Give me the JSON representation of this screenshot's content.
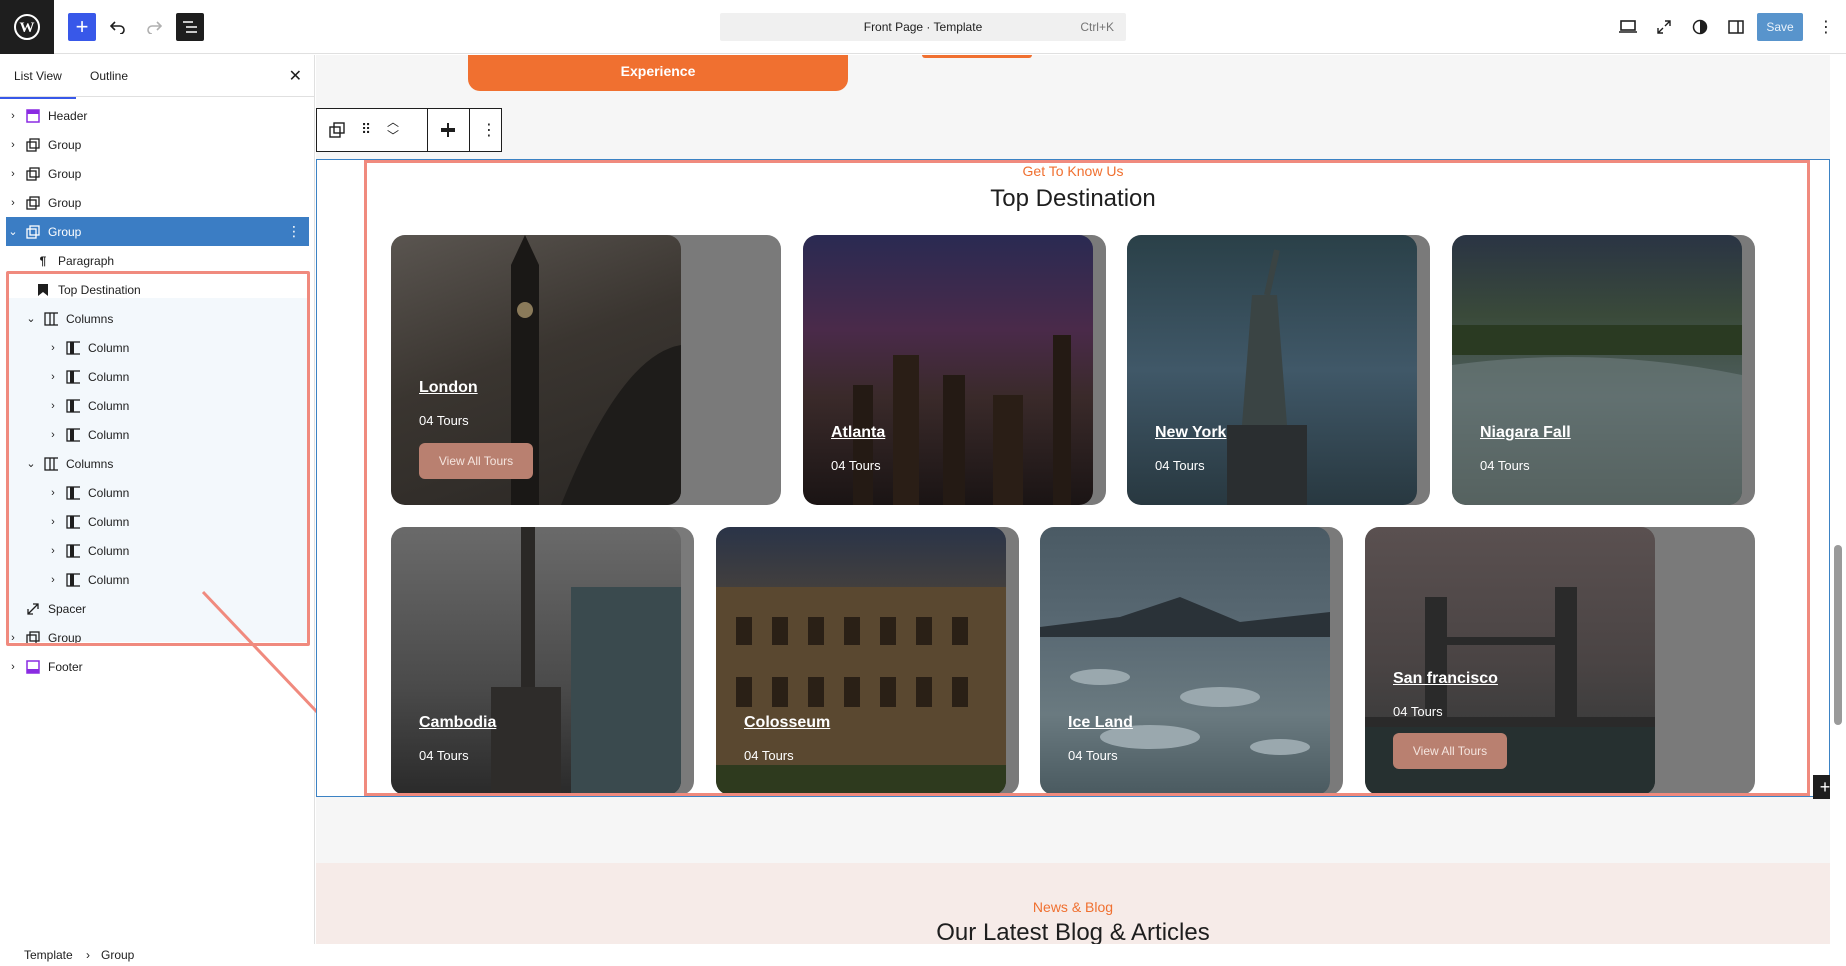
{
  "topbar": {
    "doc_title": "Front Page · Template",
    "shortcut": "Ctrl+K",
    "save_label": "Save",
    "icons": [
      "wordpress-logo",
      "plus-icon",
      "undo-icon",
      "redo-icon",
      "list-view-icon",
      "desktop-icon",
      "fullscreen-icon",
      "contrast-icon",
      "sidebar-icon",
      "more-icon"
    ]
  },
  "sidebar": {
    "tabs": [
      "List View",
      "Outline"
    ],
    "items": [
      {
        "label": "Header",
        "icon": "template-part-icon"
      },
      {
        "label": "Group",
        "icon": "group-icon"
      },
      {
        "label": "Group",
        "icon": "group-icon"
      },
      {
        "label": "Group",
        "icon": "group-icon"
      },
      {
        "label": "Group",
        "icon": "group-icon"
      },
      {
        "label": "Paragraph",
        "icon": "paragraph-icon"
      },
      {
        "label": "Top Destination",
        "icon": "heading-icon"
      },
      {
        "label": "Columns",
        "icon": "columns-icon"
      },
      {
        "label": "Column",
        "icon": "column-icon"
      },
      {
        "label": "Column",
        "icon": "column-icon"
      },
      {
        "label": "Column",
        "icon": "column-icon"
      },
      {
        "label": "Column",
        "icon": "column-icon"
      },
      {
        "label": "Columns",
        "icon": "columns-icon"
      },
      {
        "label": "Column",
        "icon": "column-icon"
      },
      {
        "label": "Column",
        "icon": "column-icon"
      },
      {
        "label": "Column",
        "icon": "column-icon"
      },
      {
        "label": "Column",
        "icon": "column-icon"
      },
      {
        "label": "Spacer",
        "icon": "spacer-icon"
      },
      {
        "label": "Group",
        "icon": "group-icon"
      },
      {
        "label": "Footer",
        "icon": "template-part-icon"
      }
    ]
  },
  "breadcrumb": {
    "root": "Template",
    "current": "Group"
  },
  "canvas": {
    "experience_label": "Experience",
    "kicker": "Get To Know Us",
    "heading": "Top Destination",
    "cards": [
      {
        "name": "London",
        "count": "04 Tours",
        "button": "View All Tours"
      },
      {
        "name": "Atlanta",
        "count": "04 Tours"
      },
      {
        "name": "New York",
        "count": "04 Tours"
      },
      {
        "name": "Niagara Fall",
        "count": "04 Tours"
      },
      {
        "name": "Cambodia",
        "count": "04 Tours"
      },
      {
        "name": "Colosseum",
        "count": "04 Tours"
      },
      {
        "name": "Ice Land",
        "count": "04 Tours"
      },
      {
        "name": "San francisco",
        "count": "04 Tours",
        "button": "View All Tours"
      }
    ],
    "news_kicker": "News & Blog",
    "news_heading": "Our Latest Blog & Articles"
  },
  "colors": {
    "accent": "#3858e9",
    "brand_orange": "#f07030",
    "annotation": "#f08a7e"
  }
}
